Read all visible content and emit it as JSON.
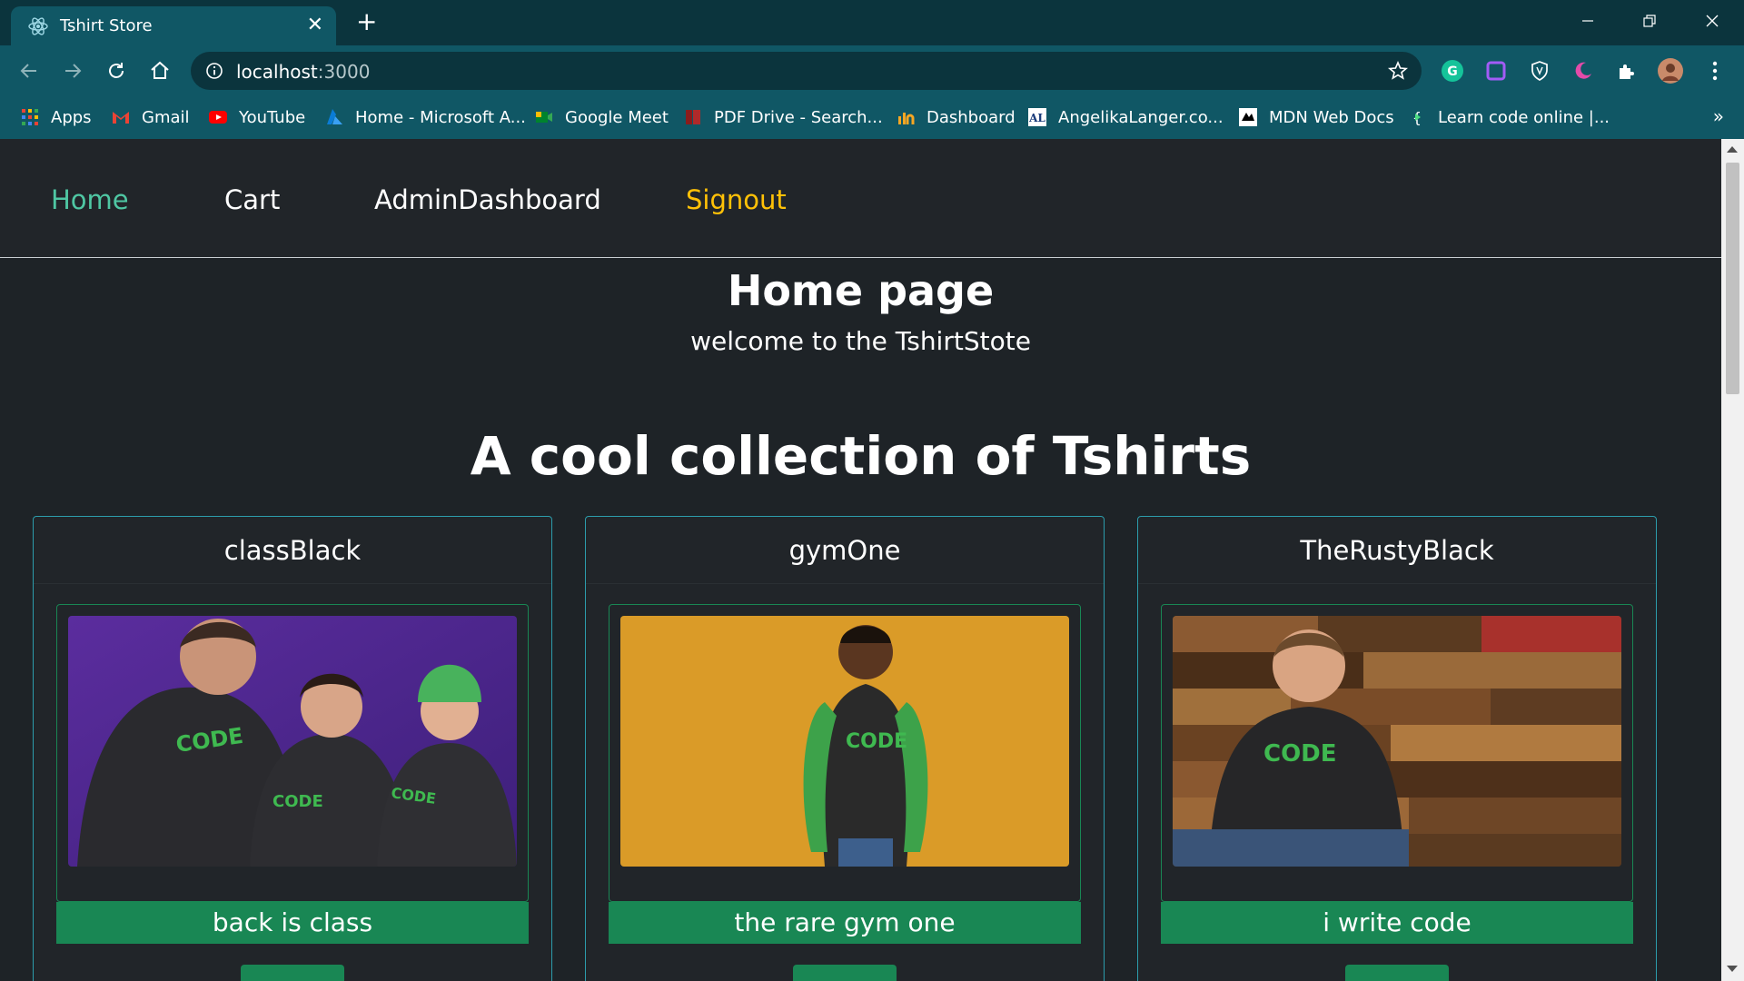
{
  "browser": {
    "tab_title": "Tshirt Store",
    "url_host": "localhost",
    "url_port": ":3000",
    "bookmarks": [
      {
        "label": "Apps",
        "icon": "apps-grid-icon"
      },
      {
        "label": "Gmail",
        "icon": "gmail-icon"
      },
      {
        "label": "YouTube",
        "icon": "youtube-icon"
      },
      {
        "label": "Home - Microsoft A...",
        "icon": "azure-icon"
      },
      {
        "label": "Google Meet",
        "icon": "google-meet-icon"
      },
      {
        "label": "PDF Drive - Search...",
        "icon": "pdf-drive-icon"
      },
      {
        "label": "Dashboard",
        "icon": "dashboard-icon"
      },
      {
        "label": "AngelikaLanger.co...",
        "icon": "angelikalanger-icon"
      },
      {
        "label": "MDN Web Docs",
        "icon": "mdn-icon"
      },
      {
        "label": "Learn code online |...",
        "icon": "codecademy-icon"
      }
    ],
    "more_bookmarks": "»"
  },
  "nav": {
    "home": "Home",
    "cart": "Cart",
    "admin": "AdminDashboard",
    "signout": "Signout"
  },
  "hero": {
    "title": "Home page",
    "subtitle": "welcome to the TshirtStote"
  },
  "section_title": "A cool collection of Tshirts",
  "products": [
    {
      "name": "classBlack",
      "description": "back is class"
    },
    {
      "name": "gymOne",
      "description": "the rare gym one"
    },
    {
      "name": "TheRustyBlack",
      "description": "i write code"
    }
  ],
  "colors": {
    "chrome_dark": "#0b343d",
    "chrome_light": "#105765",
    "page_bg": "#1e2327",
    "nav_active": "#4fc7a3",
    "nav_warning": "#ffc107",
    "card_border": "#2c9cab",
    "success": "#198754"
  }
}
